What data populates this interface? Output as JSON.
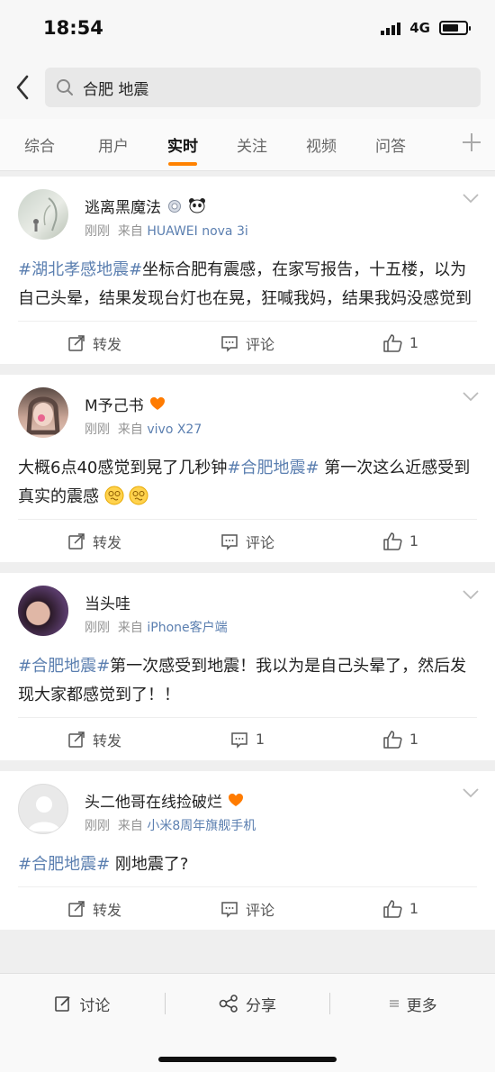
{
  "status": {
    "time": "18:54",
    "network": "4G"
  },
  "search": {
    "query": "合肥 地震"
  },
  "tabs": [
    {
      "label": "综合"
    },
    {
      "label": "用户"
    },
    {
      "label": "实时",
      "active": true
    },
    {
      "label": "关注"
    },
    {
      "label": "视频"
    },
    {
      "label": "问答"
    }
  ],
  "posts": [
    {
      "username": "逃离黑魔法",
      "time": "刚刚",
      "source_prefix": "来自",
      "source": "HUAWEI nova 3i",
      "text_parts": [
        {
          "text": "#湖北孝感地震#",
          "tag": true
        },
        {
          "text": "坐标合肥有震感，在家写报告，十五楼，以为自己头晕，结果发现台灯也在晃，狂喊我妈，结果我妈没感觉到",
          "tag": false
        }
      ],
      "repost_label": "转发",
      "comment_label": "评论",
      "like_count": "1"
    },
    {
      "username": "M予己书",
      "time": "刚刚",
      "source_prefix": "来自",
      "source": "vivo X27",
      "text_parts": [
        {
          "text": "大概6点40感觉到晃了几秒钟",
          "tag": false
        },
        {
          "text": "#合肥地震#",
          "tag": true
        },
        {
          "text": "第一次这么近感受到真实的震感",
          "tag": false
        }
      ],
      "repost_label": "转发",
      "comment_label": "评论",
      "like_count": "1"
    },
    {
      "username": "当头哇",
      "time": "刚刚",
      "source_prefix": "来自",
      "source": "iPhone客户端",
      "text_parts": [
        {
          "text": "#合肥地震#",
          "tag": true
        },
        {
          "text": "第一次感受到地震！我以为是自己头晕了，然后发现大家都感觉到了！！",
          "tag": false
        }
      ],
      "repost_label": "转发",
      "comment_label": "1",
      "like_count": "1"
    },
    {
      "username": "头二他哥在线捡破烂",
      "time": "刚刚",
      "source_prefix": "来自",
      "source": "小米8周年旗舰手机",
      "text_parts": [
        {
          "text": "#合肥地震#",
          "tag": true
        },
        {
          "text": "刚地震了?",
          "tag": false
        }
      ],
      "repost_label": "转发",
      "comment_label": "评论",
      "like_count": "1"
    }
  ],
  "bottom": {
    "discuss": "讨论",
    "share": "分享",
    "more": "更多"
  },
  "colors": {
    "accent": "#ff8200",
    "link": "#5b7fb0",
    "heart": "#ff7b00"
  }
}
